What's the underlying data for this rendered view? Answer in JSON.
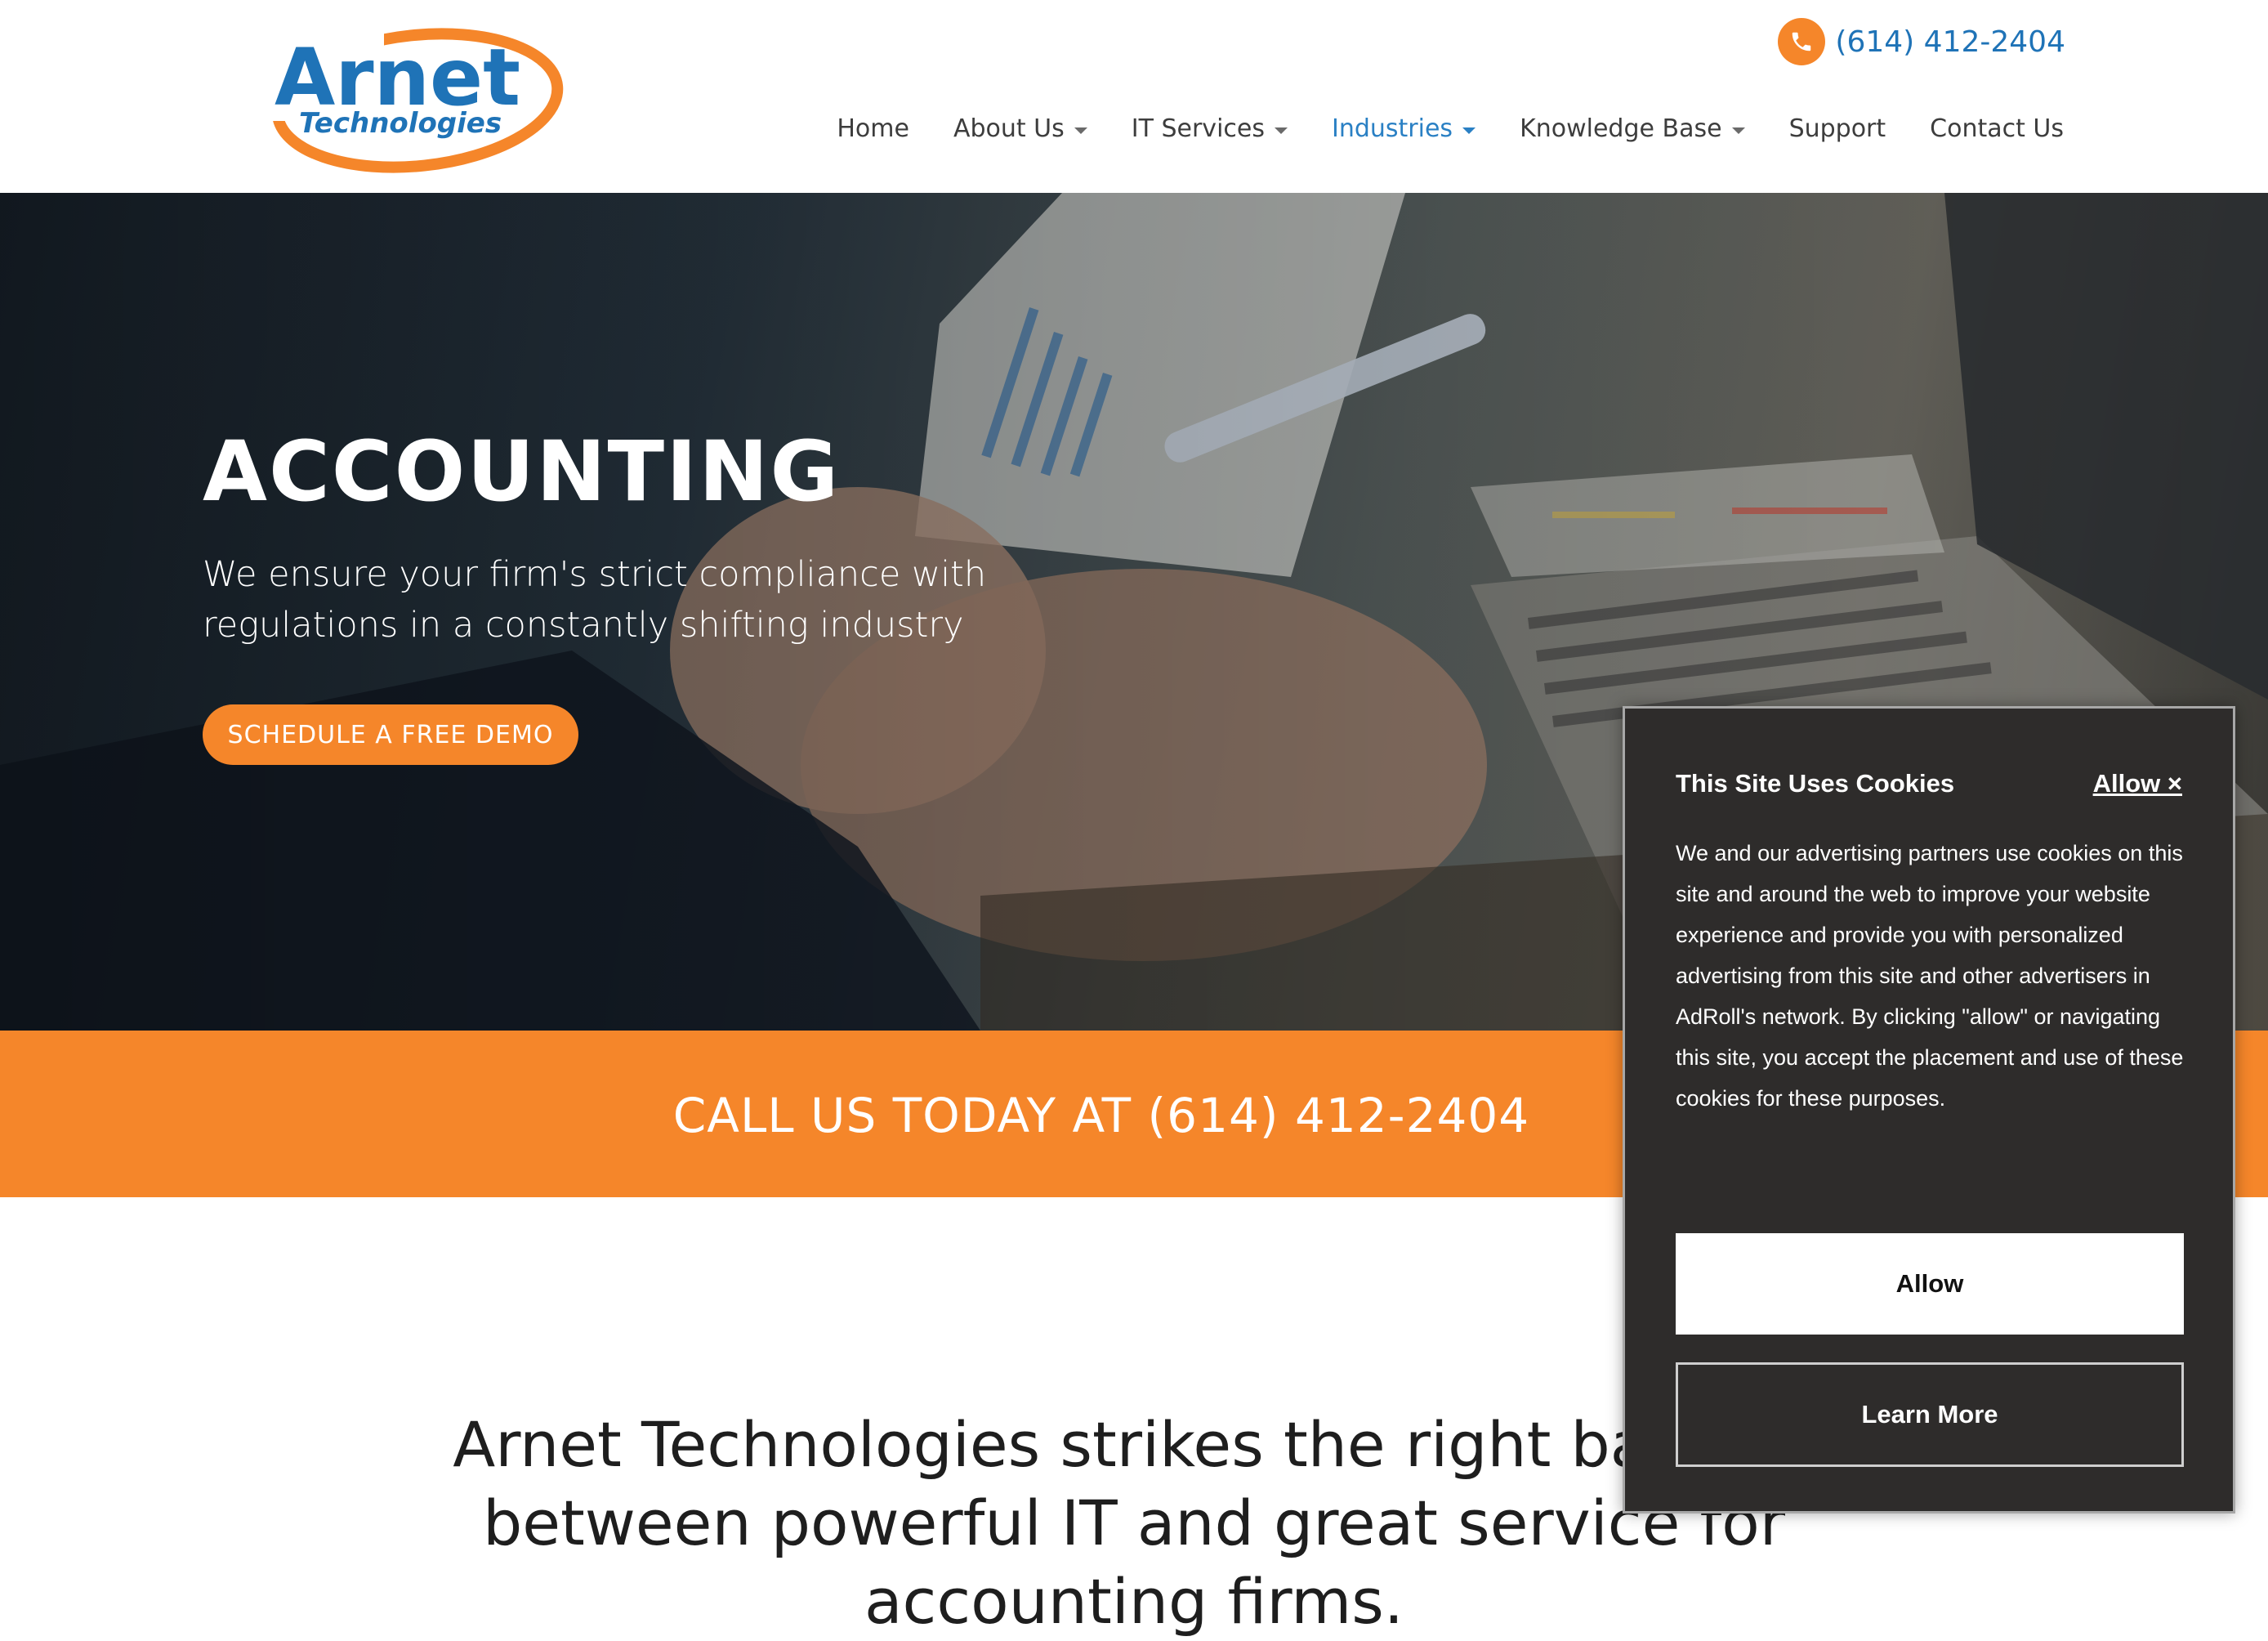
{
  "header": {
    "logo": {
      "word1": "Arnet",
      "word2": "Technologies"
    },
    "phone": "(614) 412-2404",
    "nav": [
      {
        "label": "Home",
        "dropdown": false
      },
      {
        "label": "About Us",
        "dropdown": true
      },
      {
        "label": "IT Services",
        "dropdown": true
      },
      {
        "label": "Industries",
        "dropdown": true,
        "active": true
      },
      {
        "label": "Knowledge Base",
        "dropdown": true
      },
      {
        "label": "Support",
        "dropdown": false
      },
      {
        "label": "Contact Us",
        "dropdown": false
      }
    ]
  },
  "hero": {
    "title": "ACCOUNTING",
    "subtitle": "We ensure your firm's strict compliance with regulations in a constantly shifting industry",
    "cta": "SCHEDULE A FREE DEMO"
  },
  "callband": {
    "text": "CALL US TODAY AT (614) 412-2404"
  },
  "intro": {
    "heading": "Arnet Technologies strikes the right balance between powerful IT and great service for accounting firms."
  },
  "cookie": {
    "title": "This Site Uses Cookies",
    "close_link": "Allow ×",
    "body": "We and our advertising partners use cookies on this site and around the web to improve your website experience and provide you with personalized advertising from this site and other advertisers in AdRoll's network. By clicking \"allow\" or navigating this site, you accept the placement and use of these cookies for these purposes.",
    "allow_button": "Allow",
    "learn_more_button": "Learn More"
  },
  "colors": {
    "brand_orange": "#f5862a",
    "link_blue": "#1f73b7",
    "cookie_bg": "#2e2c2b"
  },
  "icons": {
    "phone": "phone-icon",
    "dropdown": "caret-down-icon"
  }
}
